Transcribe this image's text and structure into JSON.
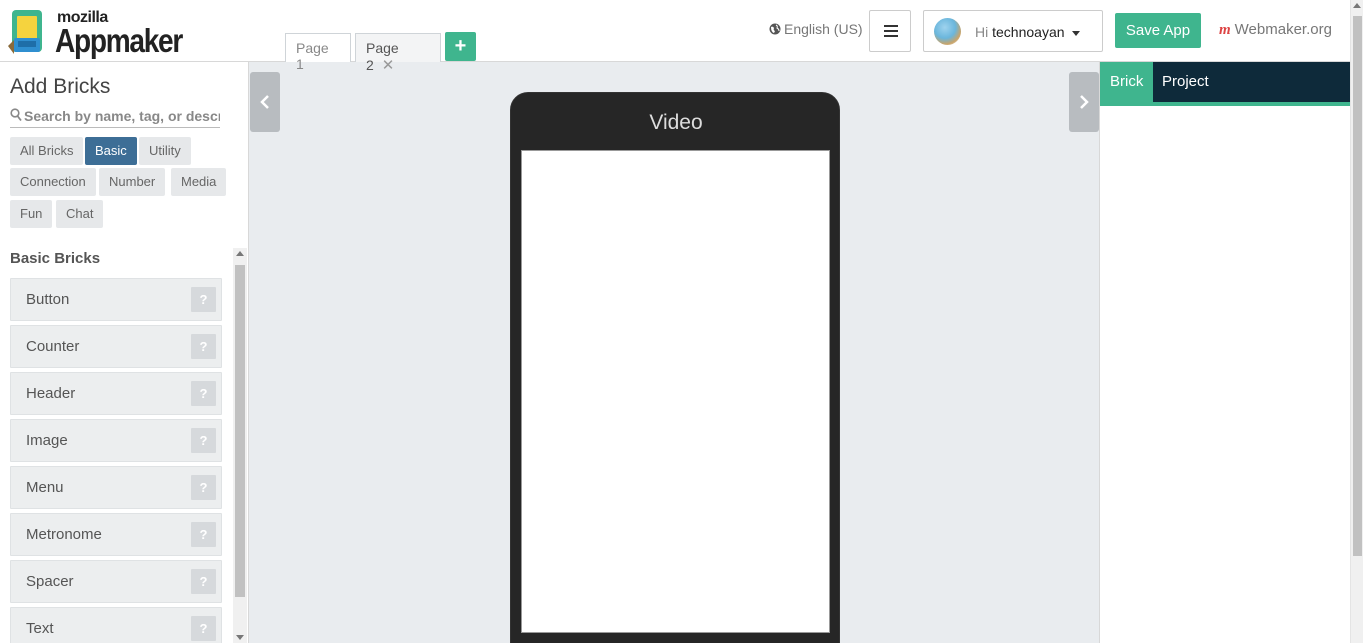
{
  "header": {
    "logo_top": "mozilla",
    "logo_main": "Appmaker",
    "tabs": [
      {
        "label": "Page 1",
        "active": false
      },
      {
        "label": "Page 2",
        "active": true,
        "close": "✕"
      }
    ],
    "add_page": "+",
    "language": "English (US)",
    "greeting": "Hi",
    "username": "technoayan",
    "save_label": "Save App",
    "webmaker_label": "Webmaker.org",
    "webmaker_logo": "m"
  },
  "sidebar": {
    "title": "Add Bricks",
    "search_placeholder": "Search by name, tag, or description",
    "filters": [
      "All Bricks",
      "Basic",
      "Utility",
      "Connection",
      "Number",
      "Media",
      "Fun",
      "Chat"
    ],
    "active_filter": "Basic",
    "section_title": "Basic Bricks",
    "bricks": [
      "Button",
      "Counter",
      "Header",
      "Image",
      "Menu",
      "Metronome",
      "Spacer",
      "Text"
    ],
    "help_glyph": "?"
  },
  "canvas": {
    "phone_title": "Video"
  },
  "right_panel": {
    "tabs": [
      "Brick",
      "Project"
    ],
    "active_tab": "Brick"
  },
  "colors": {
    "accent": "#3fb58e",
    "active_filter": "#3d6e96",
    "panel_tabs_bg": "#0e2a3a"
  },
  "icons": [
    "appmaker-logo-icon",
    "globe-icon",
    "hamburger-icon",
    "chevron-left-icon",
    "chevron-right-icon",
    "search-icon",
    "close-icon"
  ]
}
